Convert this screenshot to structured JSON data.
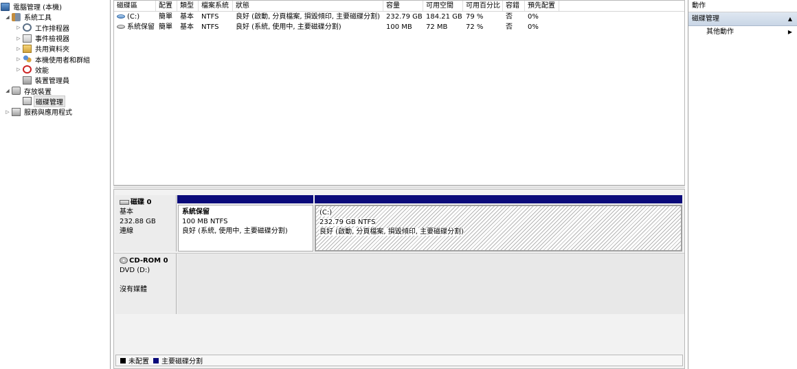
{
  "tree": {
    "root": "電腦管理 (本機)",
    "system_tools": "系統工具",
    "task_scheduler": "工作排程器",
    "event_viewer": "事件檢視器",
    "shared_folders": "共用資料夾",
    "local_users": "本機使用者和群組",
    "performance": "效能",
    "device_manager": "裝置管理員",
    "storage": "存放裝置",
    "disk_management": "磁碟管理",
    "services": "服務與應用程式"
  },
  "volumes": {
    "headers": [
      "磁碟區",
      "配置",
      "類型",
      "檔案系統",
      "狀態",
      "容量",
      "可用空間",
      "可用百分比",
      "容錯",
      "預先配置"
    ],
    "rows": [
      [
        "(C:)",
        "簡單",
        "基本",
        "NTFS",
        "良好 (啟動, 分頁檔案, 損毀傾印, 主要磁碟分割)",
        "232.79 GB",
        "184.21 GB",
        "79 %",
        "否",
        "0%"
      ],
      [
        "系統保留",
        "簡單",
        "基本",
        "NTFS",
        "良好 (系統, 使用中, 主要磁碟分割)",
        "100 MB",
        "72 MB",
        "72 %",
        "否",
        "0%"
      ]
    ]
  },
  "disk0": {
    "name": "磁碟 0",
    "type": "基本",
    "size": "232.88 GB",
    "status": "連線",
    "partitions": [
      {
        "name": "系統保留",
        "size": "100 MB NTFS",
        "status": "良好 (系統, 使用中, 主要磁碟分割)"
      },
      {
        "name": "(C:)",
        "size": "232.79 GB NTFS",
        "status": "良好 (啟動, 分頁檔案, 損毀傾印, 主要磁碟分割)"
      }
    ]
  },
  "cdrom": {
    "name": "CD-ROM 0",
    "drive": "DVD (D:)",
    "status": "沒有媒體"
  },
  "legend": {
    "unallocated": "未配置",
    "primary": "主要磁碟分割",
    "unallocated_color": "#000000",
    "primary_color": "#0a0a7a"
  },
  "actions": {
    "header": "動作",
    "section": "磁碟管理",
    "more": "其他動作"
  }
}
